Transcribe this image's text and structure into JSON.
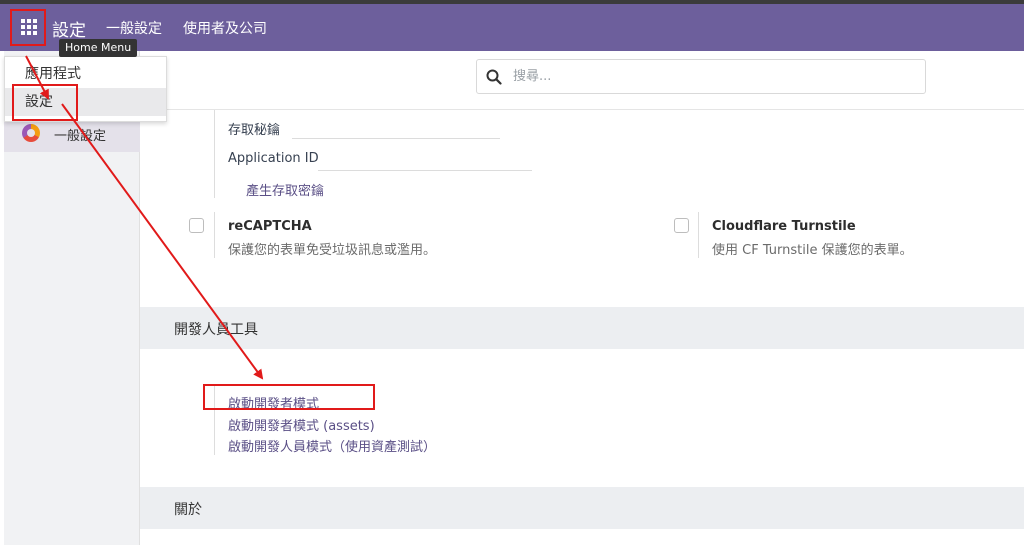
{
  "navbar": {
    "brand": "設定",
    "menus": [
      "一般設定",
      "使用者及公司"
    ],
    "color": "#6d5f9c"
  },
  "tooltip": "Home Menu",
  "dropdown": {
    "items": [
      "應用程式",
      "設定"
    ]
  },
  "sidebar": {
    "item_label": "一般設定"
  },
  "search": {
    "placeholder": "搜尋..."
  },
  "api": {
    "secret_label": "存取秘鑰",
    "appid_label": "Application ID",
    "generate_link": "產生存取密鑰"
  },
  "features": {
    "recaptcha": {
      "title": "reCAPTCHA",
      "desc": "保護您的表單免受垃圾訊息或濫用。"
    },
    "turnstile": {
      "title": "Cloudflare Turnstile",
      "desc": "使用 CF Turnstile 保護您的表單。"
    }
  },
  "dev_tools": {
    "title": "開發人員工具",
    "links": [
      "啟動開發者模式",
      "啟動開發者模式 (assets)",
      "啟動開發人員模式（使用資產測試）"
    ]
  },
  "about": {
    "title": "關於"
  },
  "annotation_color": "#e11a1a"
}
